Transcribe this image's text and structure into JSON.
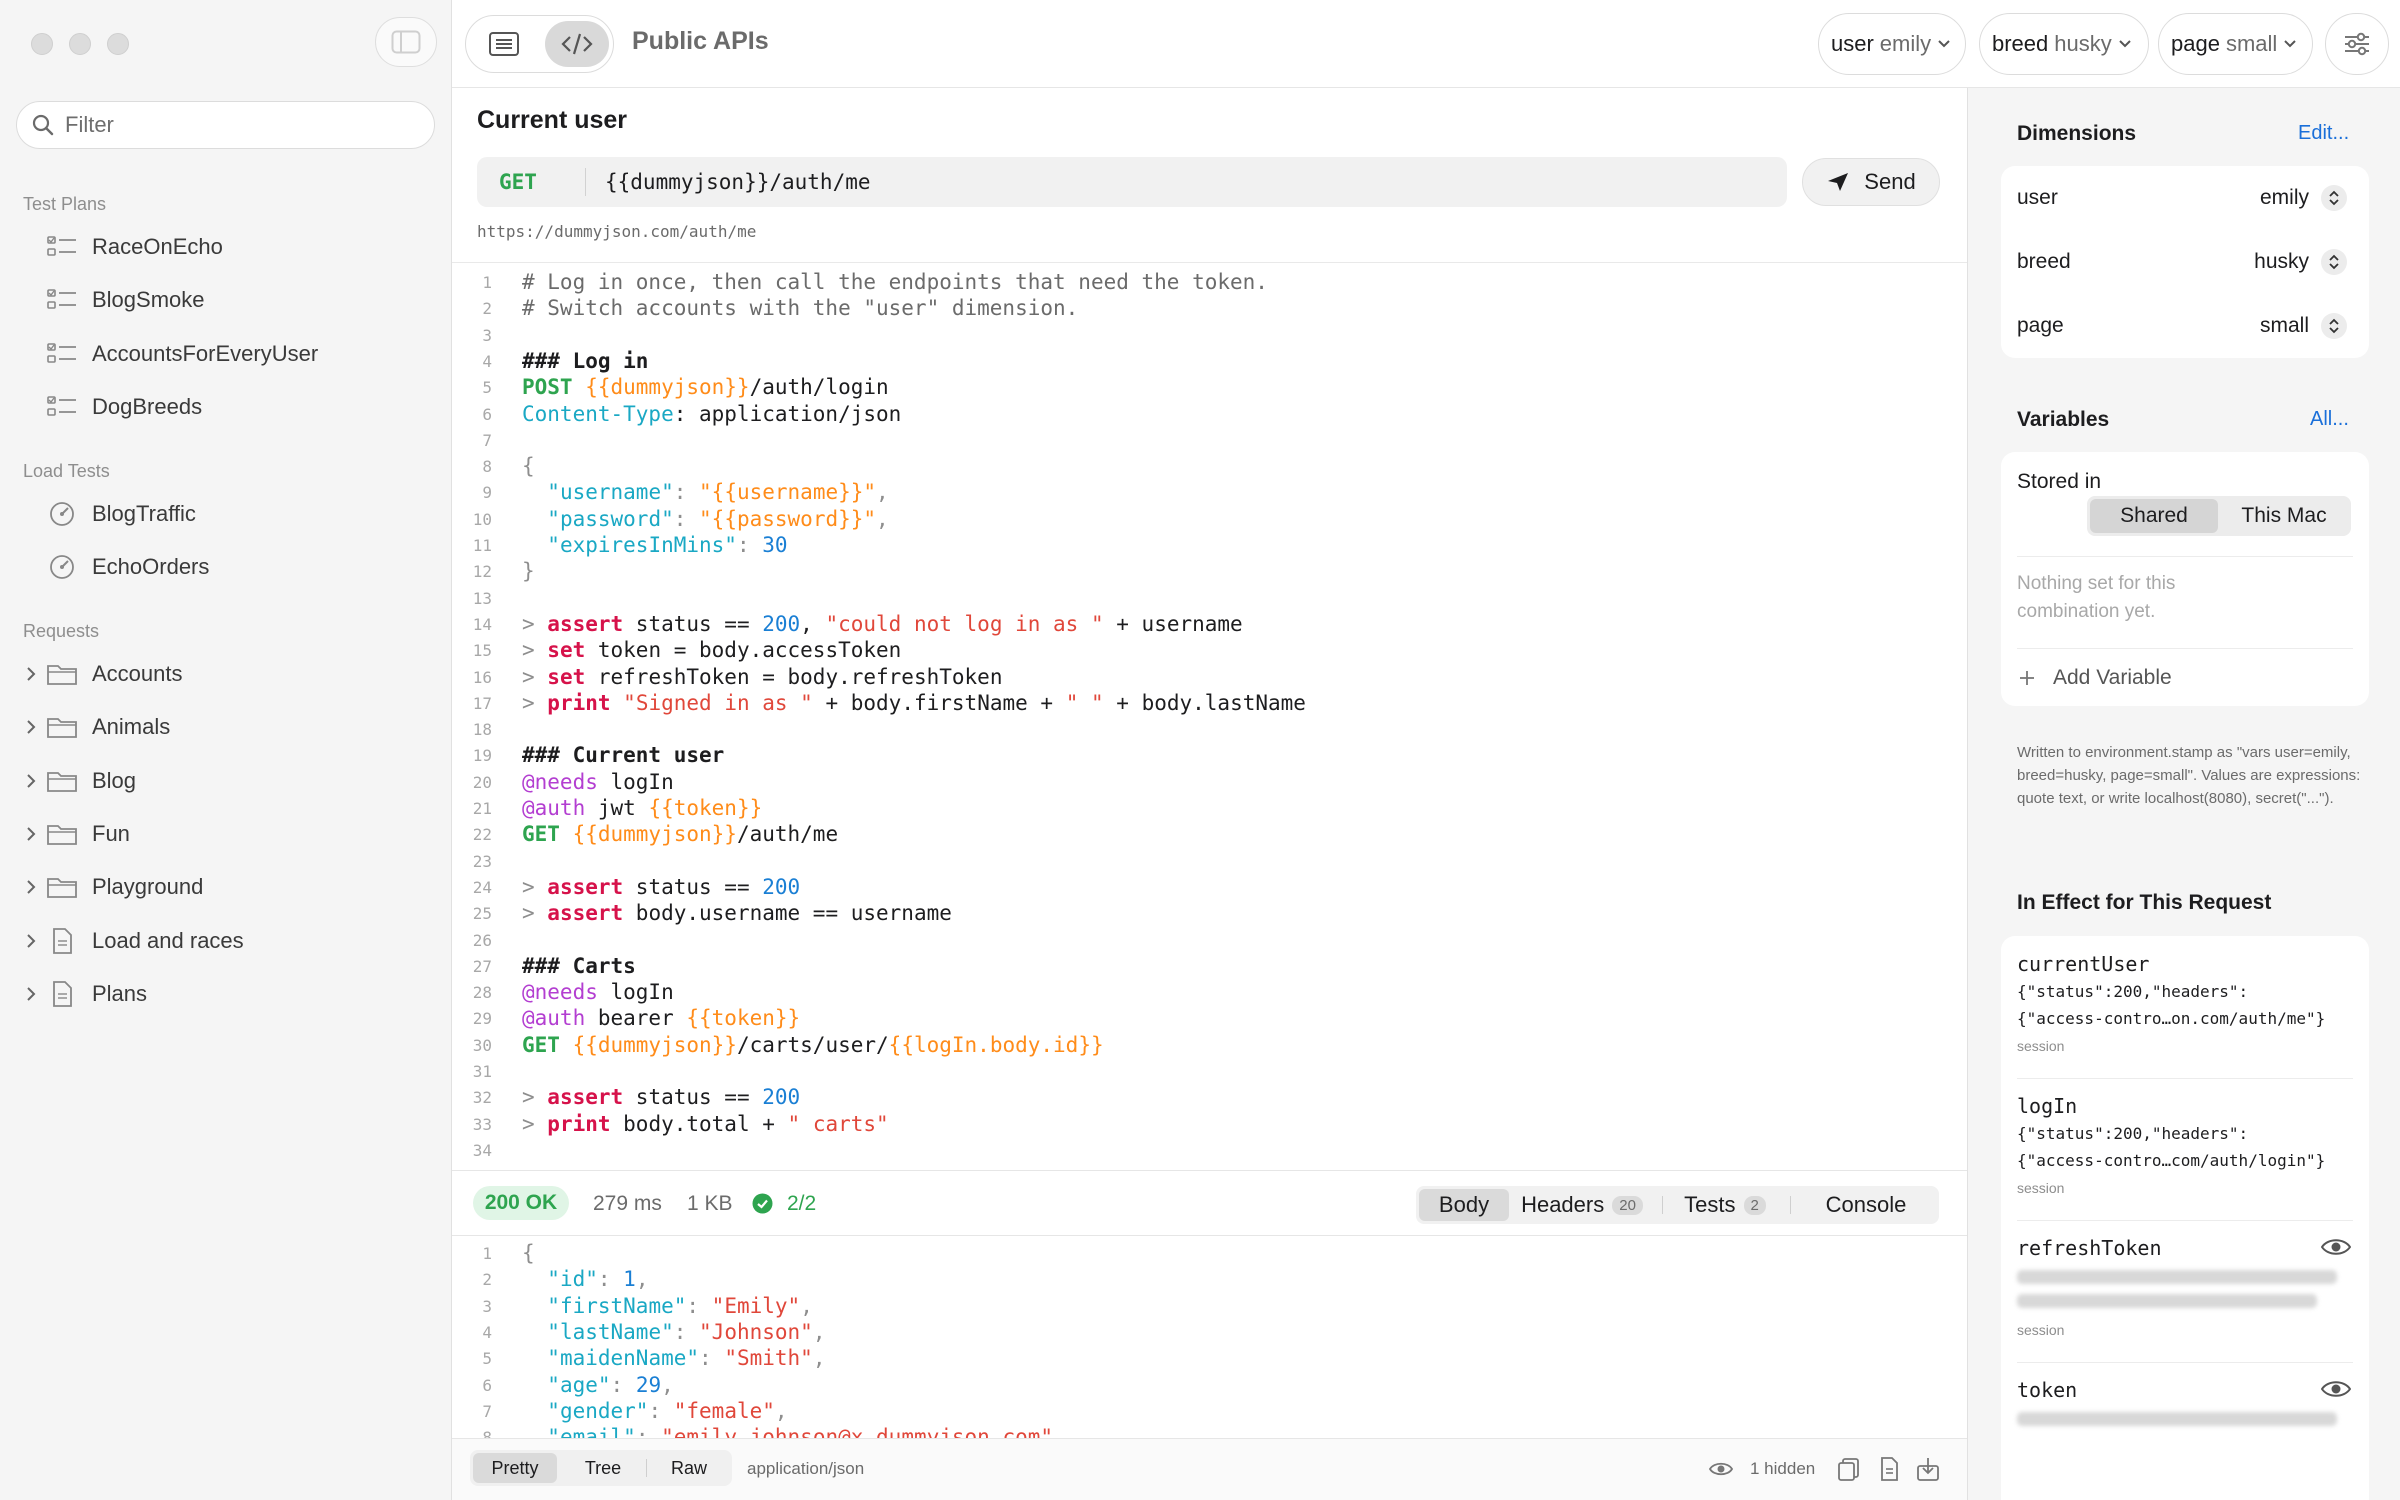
{
  "sidebar": {
    "filter_placeholder": "Filter",
    "sections": [
      {
        "header": "Test Plans",
        "items": [
          {
            "label": "RaceOnEcho",
            "icon": "checklist-icon"
          },
          {
            "label": "BlogSmoke",
            "icon": "checklist-icon"
          },
          {
            "label": "AccountsForEveryUser",
            "icon": "checklist-icon"
          },
          {
            "label": "DogBreeds",
            "icon": "checklist-icon"
          }
        ]
      },
      {
        "header": "Load Tests",
        "items": [
          {
            "label": "BlogTraffic",
            "icon": "gauge-icon"
          },
          {
            "label": "EchoOrders",
            "icon": "gauge-icon"
          }
        ]
      },
      {
        "header": "Requests",
        "items": [
          {
            "label": "Accounts",
            "icon": "folder-icon"
          },
          {
            "label": "Animals",
            "icon": "folder-icon"
          },
          {
            "label": "Blog",
            "icon": "folder-icon"
          },
          {
            "label": "Fun",
            "icon": "folder-icon"
          },
          {
            "label": "Playground",
            "icon": "folder-icon"
          },
          {
            "label": "Load and races",
            "icon": "document-icon"
          },
          {
            "label": "Plans",
            "icon": "document-icon"
          }
        ]
      }
    ]
  },
  "toolbar": {
    "title": "Public APIs",
    "dimensions": [
      {
        "key": "user",
        "value": "emily"
      },
      {
        "key": "breed",
        "value": "husky"
      },
      {
        "key": "page",
        "value": "small"
      }
    ]
  },
  "request": {
    "title": "Current user",
    "method": "GET",
    "url": "{{dummyjson}}/auth/me",
    "resolved_url": "https://dummyjson.com/auth/me",
    "send_label": "Send"
  },
  "editor": {
    "lines": [
      [
        [
          "c-com",
          "# Log in once, then call the endpoints that need the token."
        ]
      ],
      [
        [
          "c-com",
          "# Switch accounts with the \"user\" dimension."
        ]
      ],
      [],
      [
        [
          "c-bold",
          "### Log in"
        ]
      ],
      [
        [
          "c-green",
          "POST "
        ],
        [
          "c-var",
          "{{dummyjson}}"
        ],
        [
          "c-plain",
          "/auth/login"
        ]
      ],
      [
        [
          "c-teal",
          "Content-Type"
        ],
        [
          "c-plain",
          ": application/json"
        ]
      ],
      [],
      [
        [
          "c-gray",
          "{"
        ]
      ],
      [
        [
          "c-plain",
          "  "
        ],
        [
          "c-teal",
          "\"username\""
        ],
        [
          "c-gray",
          ": "
        ],
        [
          "c-var",
          "\"{{username}}\""
        ],
        [
          "c-gray",
          ","
        ]
      ],
      [
        [
          "c-plain",
          "  "
        ],
        [
          "c-teal",
          "\"password\""
        ],
        [
          "c-gray",
          ": "
        ],
        [
          "c-var",
          "\"{{password}}\""
        ],
        [
          "c-gray",
          ","
        ]
      ],
      [
        [
          "c-plain",
          "  "
        ],
        [
          "c-teal",
          "\"expiresInMins\""
        ],
        [
          "c-gray",
          ": "
        ],
        [
          "c-num",
          "30"
        ]
      ],
      [
        [
          "c-gray",
          "}"
        ]
      ],
      [],
      [
        [
          "c-gray",
          "> "
        ],
        [
          "c-kw",
          "assert"
        ],
        [
          "c-plain",
          " status == "
        ],
        [
          "c-num",
          "200"
        ],
        [
          "c-plain",
          ", "
        ],
        [
          "c-str",
          "\"could not log in as \""
        ],
        [
          "c-plain",
          " + username"
        ]
      ],
      [
        [
          "c-gray",
          "> "
        ],
        [
          "c-kw",
          "set"
        ],
        [
          "c-plain",
          " token = body.accessToken"
        ]
      ],
      [
        [
          "c-gray",
          "> "
        ],
        [
          "c-kw",
          "set"
        ],
        [
          "c-plain",
          " refreshToken = body.refreshToken"
        ]
      ],
      [
        [
          "c-gray",
          "> "
        ],
        [
          "c-kw",
          "print"
        ],
        [
          "c-plain",
          " "
        ],
        [
          "c-str",
          "\"Signed in as \""
        ],
        [
          "c-plain",
          " + body.firstName + "
        ],
        [
          "c-str",
          "\" \""
        ],
        [
          "c-plain",
          " + body.lastName"
        ]
      ],
      [],
      [
        [
          "c-bold",
          "### Current user"
        ]
      ],
      [
        [
          "c-purple",
          "@needs"
        ],
        [
          "c-plain",
          " logIn"
        ]
      ],
      [
        [
          "c-purple",
          "@auth"
        ],
        [
          "c-plain",
          " jwt "
        ],
        [
          "c-var",
          "{{token}}"
        ]
      ],
      [
        [
          "c-green",
          "GET "
        ],
        [
          "c-var",
          "{{dummyjson}}"
        ],
        [
          "c-plain",
          "/auth/me"
        ]
      ],
      [],
      [
        [
          "c-gray",
          "> "
        ],
        [
          "c-kw",
          "assert"
        ],
        [
          "c-plain",
          " status == "
        ],
        [
          "c-num",
          "200"
        ]
      ],
      [
        [
          "c-gray",
          "> "
        ],
        [
          "c-kw",
          "assert"
        ],
        [
          "c-plain",
          " body.username == username"
        ]
      ],
      [],
      [
        [
          "c-bold",
          "### Carts"
        ]
      ],
      [
        [
          "c-purple",
          "@needs"
        ],
        [
          "c-plain",
          " logIn"
        ]
      ],
      [
        [
          "c-purple",
          "@auth"
        ],
        [
          "c-plain",
          " bearer "
        ],
        [
          "c-var",
          "{{token}}"
        ]
      ],
      [
        [
          "c-green",
          "GET "
        ],
        [
          "c-var",
          "{{dummyjson}}"
        ],
        [
          "c-plain",
          "/carts/user/"
        ],
        [
          "c-var",
          "{{logIn.body.id}}"
        ]
      ],
      [],
      [
        [
          "c-gray",
          "> "
        ],
        [
          "c-kw",
          "assert"
        ],
        [
          "c-plain",
          " status == "
        ],
        [
          "c-num",
          "200"
        ]
      ],
      [
        [
          "c-gray",
          "> "
        ],
        [
          "c-kw",
          "print"
        ],
        [
          "c-plain",
          " body.total + "
        ],
        [
          "c-str",
          "\" carts\""
        ]
      ],
      []
    ]
  },
  "response": {
    "status": "200 OK",
    "time": "279 ms",
    "size": "1 KB",
    "tests_passed": "2/2",
    "tabs": [
      {
        "label": "Body"
      },
      {
        "label": "Headers",
        "count": "20"
      },
      {
        "label": "Tests",
        "count": "2"
      },
      {
        "label": "Console"
      }
    ],
    "body_lines": [
      [
        [
          "c-gray",
          "{"
        ]
      ],
      [
        [
          "c-plain",
          "  "
        ],
        [
          "c-teal",
          "\"id\""
        ],
        [
          "c-gray",
          ": "
        ],
        [
          "c-num",
          "1"
        ],
        [
          "c-gray",
          ","
        ]
      ],
      [
        [
          "c-plain",
          "  "
        ],
        [
          "c-teal",
          "\"firstName\""
        ],
        [
          "c-gray",
          ": "
        ],
        [
          "c-str",
          "\"Emily\""
        ],
        [
          "c-gray",
          ","
        ]
      ],
      [
        [
          "c-plain",
          "  "
        ],
        [
          "c-teal",
          "\"lastName\""
        ],
        [
          "c-gray",
          ": "
        ],
        [
          "c-str",
          "\"Johnson\""
        ],
        [
          "c-gray",
          ","
        ]
      ],
      [
        [
          "c-plain",
          "  "
        ],
        [
          "c-teal",
          "\"maidenName\""
        ],
        [
          "c-gray",
          ": "
        ],
        [
          "c-str",
          "\"Smith\""
        ],
        [
          "c-gray",
          ","
        ]
      ],
      [
        [
          "c-plain",
          "  "
        ],
        [
          "c-teal",
          "\"age\""
        ],
        [
          "c-gray",
          ": "
        ],
        [
          "c-num",
          "29"
        ],
        [
          "c-gray",
          ","
        ]
      ],
      [
        [
          "c-plain",
          "  "
        ],
        [
          "c-teal",
          "\"gender\""
        ],
        [
          "c-gray",
          ": "
        ],
        [
          "c-str",
          "\"female\""
        ],
        [
          "c-gray",
          ","
        ]
      ],
      [
        [
          "c-plain",
          "  "
        ],
        [
          "c-teal",
          "\"email\""
        ],
        [
          "c-gray",
          ": "
        ],
        [
          "c-str",
          "\"emily.johnson@x.dummyjson.com\""
        ],
        [
          "c-gray",
          ","
        ]
      ]
    ],
    "view_modes": [
      "Pretty",
      "Tree",
      "Raw"
    ],
    "content_type": "application/json",
    "hidden_count": "1 hidden"
  },
  "inspector": {
    "dimensions_title": "Dimensions",
    "dimensions_edit": "Edit...",
    "dimensions": [
      {
        "key": "user",
        "value": "emily"
      },
      {
        "key": "breed",
        "value": "husky"
      },
      {
        "key": "page",
        "value": "small"
      }
    ],
    "variables_title": "Variables",
    "variables_all": "All...",
    "stored_in_label": "Stored in",
    "stored_in_options": [
      "Shared",
      "This Mac"
    ],
    "empty_message": "Nothing set for this combination yet.",
    "add_variable": "Add Variable",
    "note": "Written to environment.stamp as \"vars user=emily, breed=husky, page=small\". Values are expressions: quote text, or write localhost(8080), secret(\"...\").",
    "in_effect_title": "In Effect for This Request",
    "in_effect": [
      {
        "name": "currentUser",
        "value_line1": "{\"status\":200,\"headers\":",
        "value_line2": "{\"access-contro…on.com/auth/me\"}",
        "scope": "session"
      },
      {
        "name": "logIn",
        "value_line1": "{\"status\":200,\"headers\":",
        "value_line2": "{\"access-contro…com/auth/login\"}",
        "scope": "session"
      },
      {
        "name": "refreshToken",
        "scope": "session",
        "masked": true
      },
      {
        "name": "token",
        "masked": true
      }
    ]
  },
  "colors": {
    "accent": "#1a6fd9",
    "ok": "#2ea44f",
    "keyword": "#d6124a",
    "variable": "#ff8c1a"
  }
}
